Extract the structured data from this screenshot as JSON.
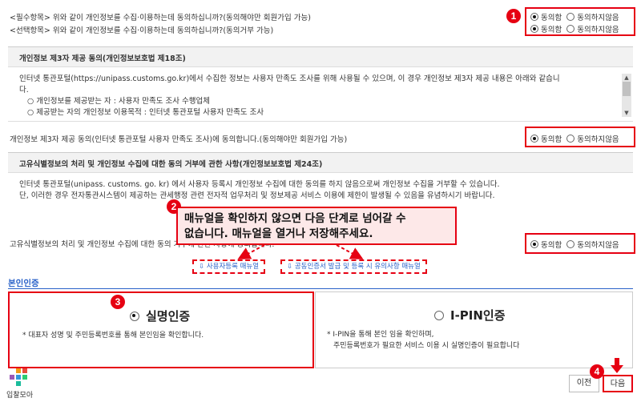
{
  "consent": {
    "required_text": "<필수항목> 위와 같이 개인정보를 수집·이용하는데 동의하십니까?(동의해야만 회원가입 가능)",
    "optional_text": "<선택항목> 위와 같이 개인정보를 수집·이용하는데 동의하십니까?(동의거부 가능)",
    "agree": "동의함",
    "disagree": "동의하지않음"
  },
  "third_party": {
    "title": "개인정보 제3자 제공 동의(개인정보보호법 제18조)",
    "body_line1": "인터넷 통관포털(https://unipass.customs.go.kr)에서 수집한 정보는 사용자 만족도 조사를 위해 사용될 수 있으며, 이 경우 개인정보 제3자 제공 내용은 아래와 같습니",
    "body_line2": "다.",
    "item1": "○ 개인정보를 제공받는 자 : 사용자 만족도 조사 수행업체",
    "item2": "○ 제공받는 자의 개인정보 이용목적 : 인터넷 통관포털 사용자 만족도 조사",
    "question": "개인정보 제3자 제공 동의(인터넷 통관포털 사용자 만족도 조사)에 동의합니다.(동의해야만 회원가입 가능)"
  },
  "unique_id": {
    "title": "고유식별정보의 처리 및 개인정보 수집에 대한 동의 거부에 관한 사항(개인정보보호법 제24조)",
    "body_line1": "인터넷 통관포털(unipass. customs. go. kr) 에서 사용자 등록시 개인정보 수집에 대한 동의를 하지 않음으로써 개인정보 수집을 거부할 수 있습니다.",
    "body_line2": "단, 이러한 경우 전자통관시스템이 제공하는 관세행정 관련 전자적 업무처리 및 정보제공 서비스 이용에 제한이 발생될 수 있음을 유념하시기 바랍니다.",
    "question": "고유식별정보의 처리 및 개인정보 수집에 대한 동의 거부에 관한 사항에 동의합니다."
  },
  "callout": {
    "line1": "매뉴얼을 확인하지 않으면 다음 단계로 넘어갈 수",
    "line2": "없습니다. 매뉴얼을 열거나 저장해주세요."
  },
  "manuals": {
    "user_reg": "사용자등록 매뉴얼",
    "cert": "공동인증서 발급 및 등록 시 유의사항 매뉴얼"
  },
  "auth": {
    "section_title": "본인인증",
    "realname_title": "실명인증",
    "realname_desc": "* 대표자 성명 및 주민등록번호를 통해 본인임을 확인합니다.",
    "ipin_title": "I-PIN인증",
    "ipin_desc1": "* I-PIN을 통해 본인 임을 확인하며,",
    "ipin_desc2": "주민등록번호가 필요한 서비스 이용 시 실명인증이 필요합니다"
  },
  "buttons": {
    "prev": "이전",
    "next": "다음"
  },
  "badges": [
    "1",
    "2",
    "3",
    "4"
  ],
  "logo_text": "입찰모아",
  "colors": {
    "accent_red": "#e60012",
    "link_blue": "#2a62c9"
  }
}
